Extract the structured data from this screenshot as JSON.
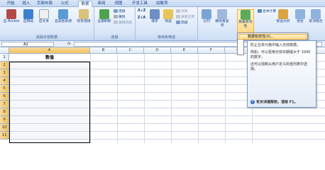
{
  "tabs": [
    "开始",
    "插入",
    "页面布局",
    "公式",
    "数据",
    "审阅",
    "视图",
    "开发工具",
    "加载项"
  ],
  "active_tab": "数据",
  "ribbon": {
    "external": {
      "label": "获取外部数据",
      "buttons": [
        "自 Access",
        "自网站",
        "自文本",
        "自其他来源",
        "现有连接"
      ]
    },
    "connections": {
      "label": "连接",
      "refresh": "全部刷新",
      "small": [
        "连接",
        "属性",
        "编辑链接"
      ]
    },
    "sort": {
      "label": "排序和筛选",
      "sort": "排序",
      "filter": "筛选",
      "small": [
        "清除",
        "重新应用",
        "高级"
      ]
    },
    "tools": {
      "buttons": [
        "分列",
        "删除重复项",
        "数据有效性",
        "合并计算",
        "假设分析",
        "组合",
        "取消组合"
      ]
    }
  },
  "formula_bar": {
    "namebox": "A2",
    "fx": "fx"
  },
  "grid": {
    "columns": [
      "A",
      "B",
      "C",
      "D",
      "E",
      "F",
      "G"
    ],
    "rows": [
      "1",
      "2",
      "3",
      "4",
      "5",
      "6",
      "7",
      "8",
      "9",
      "10",
      "11"
    ],
    "a1": "数值"
  },
  "dropdown": {
    "item": "数据有效性(V)..."
  },
  "tooltip": {
    "p1": "防止在单元格中输入无效数据。",
    "p2": "例如，可以拒绝无效日期或大于 1000 的数字。",
    "p3": "还可以强制从用户定义的值列表中选择。",
    "help": "有关详细帮助，请按 F1。"
  }
}
